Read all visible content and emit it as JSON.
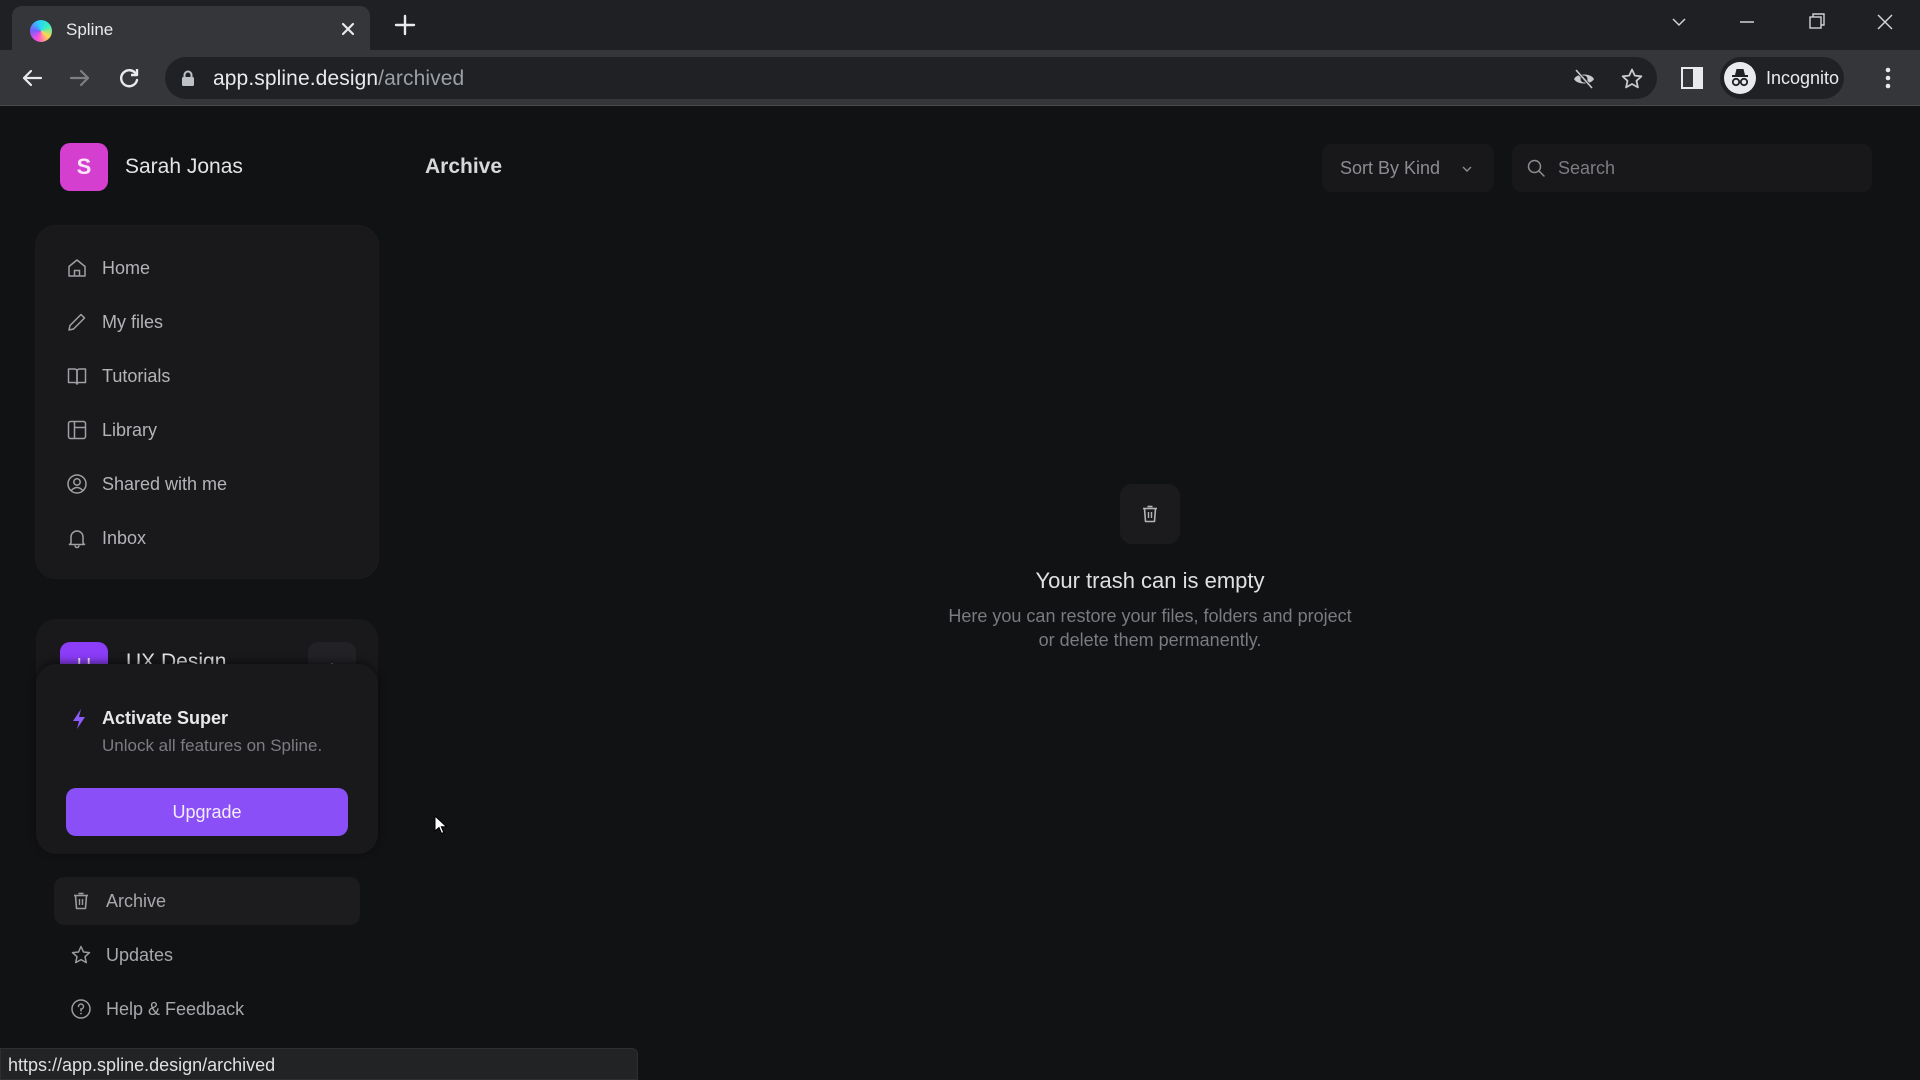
{
  "browser": {
    "tab": {
      "title": "Spline",
      "favicon": "spline-logo-icon"
    },
    "url": {
      "host": "app.spline.design",
      "path": "/archived"
    },
    "profile_label": "Incognito",
    "status_url": "https://app.spline.design/archived"
  },
  "user": {
    "initial": "S",
    "name": "Sarah Jonas",
    "avatar_color": "#d43fd0"
  },
  "sidebar": {
    "nav_items": [
      {
        "label": "Home",
        "icon": "home-icon"
      },
      {
        "label": "My files",
        "icon": "pencil-icon"
      },
      {
        "label": "Tutorials",
        "icon": "book-icon"
      },
      {
        "label": "Library",
        "icon": "layout-icon"
      },
      {
        "label": "Shared with me",
        "icon": "user-circle-icon"
      },
      {
        "label": "Inbox",
        "icon": "bell-icon"
      }
    ],
    "team": {
      "initial": "U",
      "name": "UX Design",
      "avatar_color": "#8b3df7"
    },
    "upgrade": {
      "title": "Activate Super",
      "subtitle": "Unlock all features on Spline.",
      "button": "Upgrade",
      "accent": "#8a4ff7"
    },
    "bottom_items": [
      {
        "label": "Archive",
        "icon": "trash-icon",
        "active": true
      },
      {
        "label": "Updates",
        "icon": "star-icon",
        "active": false
      },
      {
        "label": "Help & Feedback",
        "icon": "help-circle-icon",
        "active": false
      }
    ]
  },
  "main": {
    "title": "Archive",
    "sort": {
      "selected": "Sort By Kind"
    },
    "search": {
      "placeholder": "Search",
      "value": ""
    },
    "empty_state": {
      "icon": "trash-icon",
      "title": "Your trash can is empty",
      "line1": "Here you can restore your files, folders and project",
      "line2": "or delete them permanently."
    }
  }
}
